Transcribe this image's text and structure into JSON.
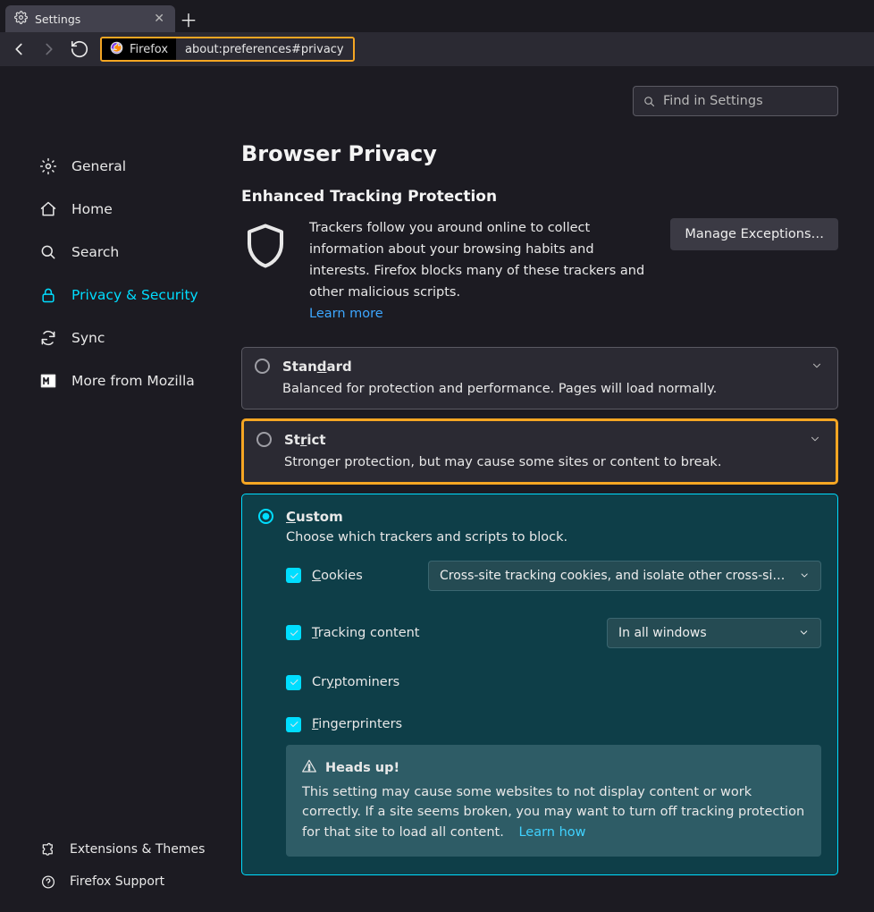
{
  "tab": {
    "title": "Settings"
  },
  "url": {
    "chip": "Firefox",
    "path": "about:preferences#privacy"
  },
  "search": {
    "placeholder": "Find in Settings"
  },
  "sidebar": {
    "items": [
      {
        "label": "General"
      },
      {
        "label": "Home"
      },
      {
        "label": "Search"
      },
      {
        "label": "Privacy & Security"
      },
      {
        "label": "Sync"
      },
      {
        "label": "More from Mozilla"
      }
    ],
    "footer": [
      {
        "label": "Extensions & Themes"
      },
      {
        "label": "Firefox Support"
      }
    ]
  },
  "page_title": "Browser Privacy",
  "section_title": "Enhanced Tracking Protection",
  "intro_text": "Trackers follow you around online to collect information about your browsing habits and interests. Firefox blocks many of these trackers and other malicious scripts.",
  "learn_more": "Learn more",
  "manage_exceptions": "Manage Exceptions…",
  "options": {
    "standard": {
      "title_pre": "Stan",
      "title_u": "d",
      "title_post": "ard",
      "desc": "Balanced for protection and performance. Pages will load normally."
    },
    "strict": {
      "title_pre": "St",
      "title_u": "r",
      "title_post": "ict",
      "desc": "Stronger protection, but may cause some sites or content to break."
    },
    "custom": {
      "title_u": "C",
      "title_post": "ustom",
      "desc": "Choose which trackers and scripts to block."
    }
  },
  "custom": {
    "cookies": {
      "label_u": "C",
      "label_post": "ookies",
      "select": "Cross-site tracking cookies, and isolate other cross-site c…"
    },
    "tracking": {
      "label_u": "T",
      "label_post": "racking content",
      "select": "In all windows"
    },
    "crypto": {
      "label_pre": "Cr",
      "label_u": "y",
      "label_post": "ptominers"
    },
    "finger": {
      "label_u": "F",
      "label_post": "ingerprinters"
    }
  },
  "info": {
    "heading": "Heads up!",
    "body": "This setting may cause some websites to not display content or work correctly. If a site seems broken, you may want to turn off tracking protection for that site to load all content.",
    "link": "Learn how"
  }
}
